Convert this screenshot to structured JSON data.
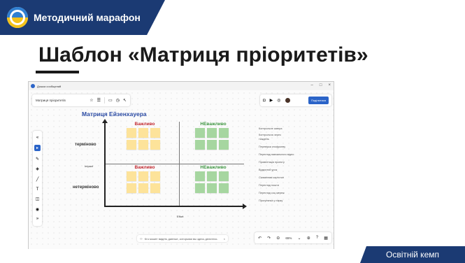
{
  "banner": {
    "title": "Методичний марафон"
  },
  "slide": {
    "title": "Шаблон «Матриця пріоритетів»"
  },
  "footer": {
    "label": "Освітній кемп"
  },
  "window": {
    "title": "Дошка сообщений",
    "controls": {
      "minimize": "–",
      "maximize": "□",
      "close": "×"
    }
  },
  "toolbar": {
    "board_name": "Матриця пріоритетів",
    "share_label": "Поділитися"
  },
  "matrix": {
    "title": "Матриця Ейзенхауера",
    "quadrants": [
      {
        "label": "Важливо",
        "color": "#c0262d",
        "sticky_color": "#fde39a"
      },
      {
        "label": "НЕважливо",
        "color": "#3d9440",
        "sticky_color": "#a6d6a0"
      },
      {
        "label": "Важливо",
        "color": "#c0262d",
        "sticky_color": "#fde39a"
      },
      {
        "label": "НЕважливо",
        "color": "#3d9440",
        "sticky_color": "#a6d6a0"
      }
    ],
    "row_labels": {
      "top": "терміново",
      "bottom": "нетерміново"
    },
    "y_axis_label": "Impact",
    "x_axis_label": "Effort"
  },
  "side_list": [
    "Контрольне завтра",
    "Контрольна через",
    "тиждень",
    "Перевірка кнофронву",
    "Перегляд навчального відео",
    "Провентація проекту",
    "Відкритий урок",
    "Скаванням картотоп",
    "Перегляд пошти",
    "Перегляд соц мереж",
    "Прогулянка у парку"
  ],
  "search_bar": {
    "text": "Кто может видеть данные, которыми вы здесь делитесь"
  },
  "zoom": {
    "level": "65%"
  },
  "icons": {
    "star": "☆",
    "menu": "☰",
    "chat": "▭",
    "timer": "◷",
    "cursor": "↖",
    "bell": "◘",
    "video": "▶",
    "sound": "◎",
    "undo": "↶",
    "redo": "↷",
    "zoom_out": "⊖",
    "zoom_in": "⊕",
    "chevron": "⌄",
    "help": "?",
    "layout": "▦"
  }
}
